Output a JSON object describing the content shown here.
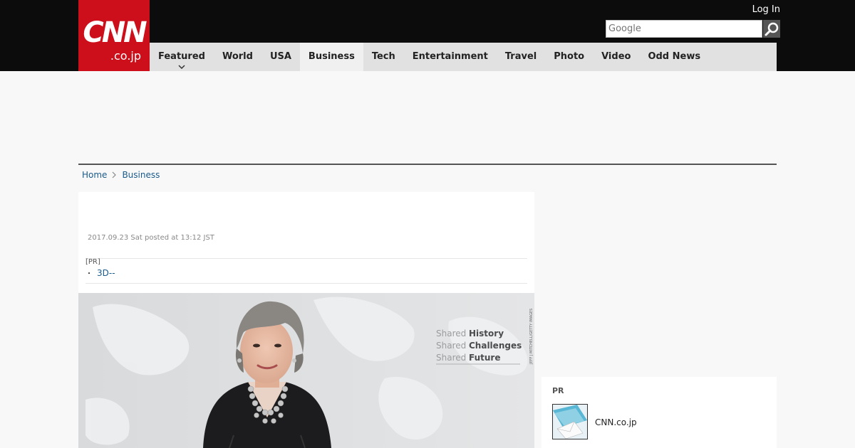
{
  "header": {
    "logo_top": "CNN",
    "logo_bottom": ".co.jp",
    "login_label": "Log In",
    "search_placeholder": "Google",
    "colors": {
      "bar": "#0c0c0c",
      "logo": "#cc0f1a",
      "nav": "#e1e1e1"
    }
  },
  "nav": {
    "items": [
      {
        "label": "Featured",
        "has_dropdown": true
      },
      {
        "label": "World"
      },
      {
        "label": "USA"
      },
      {
        "label": "Business",
        "active": true
      },
      {
        "label": "Tech"
      },
      {
        "label": "Entertainment"
      },
      {
        "label": "Travel"
      },
      {
        "label": "Photo"
      },
      {
        "label": "Video"
      },
      {
        "label": "Odd News"
      }
    ]
  },
  "breadcrumb": {
    "home": "Home",
    "section": "Business"
  },
  "article": {
    "meta": "2017.09.23 Sat posted at 13:12 JST",
    "pr_label": "[PR]",
    "pr_bullet": "・",
    "pr_link": "3D--",
    "photo": {
      "credit": "JEFF J MITCHELL/GETTY IMAGES",
      "backdrop_lines": [
        {
          "light": "Shared",
          "bold": "History"
        },
        {
          "light": "Shared",
          "bold": "Challenges"
        },
        {
          "light": "Shared",
          "bold": "Future"
        }
      ]
    }
  },
  "sidebar": {
    "pr_label": "PR",
    "pr_item": "CNN.co.jp",
    "thumb_icon": "envelope-icon"
  }
}
